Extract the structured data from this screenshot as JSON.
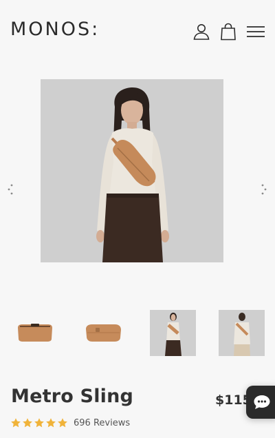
{
  "header": {
    "logo_text": "MONOS:",
    "icons": [
      "account-icon",
      "shopping-bag-icon",
      "hamburger-menu-icon"
    ]
  },
  "gallery": {
    "main_image": "model-wearing-metro-sling",
    "thumbnails": [
      "sling-front",
      "sling-angle",
      "model-front",
      "model-back"
    ]
  },
  "product": {
    "title": "Metro Sling",
    "price": "$115",
    "rating": 5,
    "reviews_label": "696 Reviews"
  },
  "colors": {
    "accent_star": "#f0b33a",
    "sling_tan": "#c58a5a",
    "chat_bg": "#2b2b2b"
  }
}
